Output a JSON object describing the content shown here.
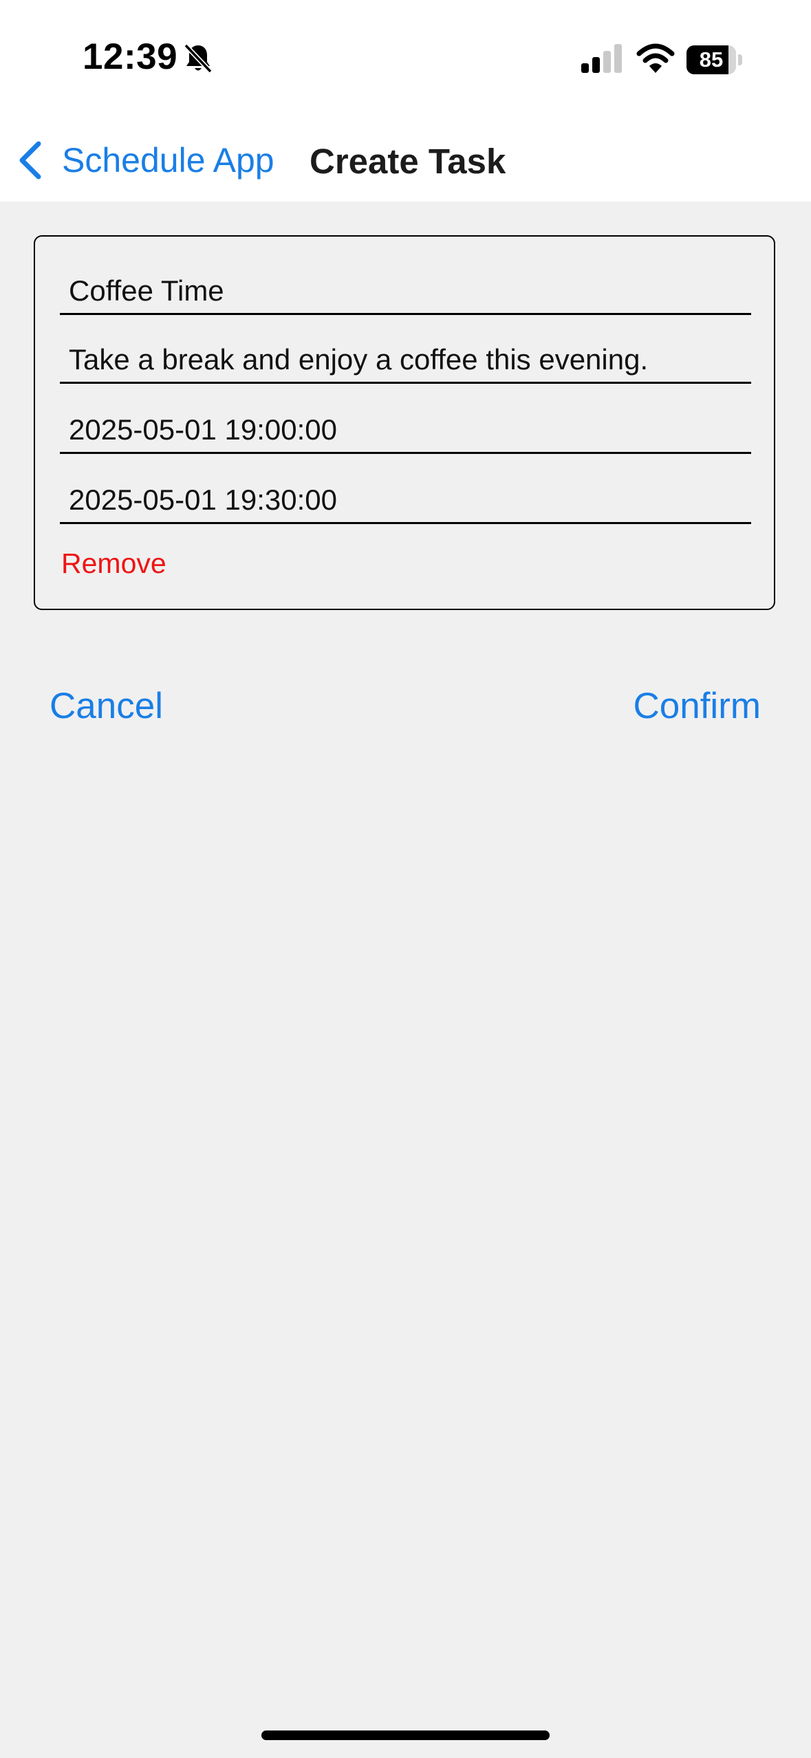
{
  "status_bar": {
    "time": "12:39",
    "battery_level": "85",
    "battery_fraction": 0.85,
    "icons": [
      "bell-slash-icon",
      "cellular-signal-icon",
      "wifi-icon",
      "battery-icon"
    ]
  },
  "nav": {
    "back_label": "Schedule App",
    "back_icon": "chevron-left-icon",
    "title": "Create Task"
  },
  "form": {
    "title_value": "Coffee Time",
    "description_value": "Take a break and enjoy a coffee this evening.",
    "start_value": "2025-05-01 19:00:00",
    "end_value": "2025-05-01 19:30:00",
    "remove_label": "Remove"
  },
  "actions": {
    "cancel_label": "Cancel",
    "confirm_label": "Confirm"
  },
  "colors": {
    "accent": "#1a7ee6",
    "destructive": "#ee1414",
    "background": "#f0f0f0",
    "bar_background": "#ffffff"
  }
}
